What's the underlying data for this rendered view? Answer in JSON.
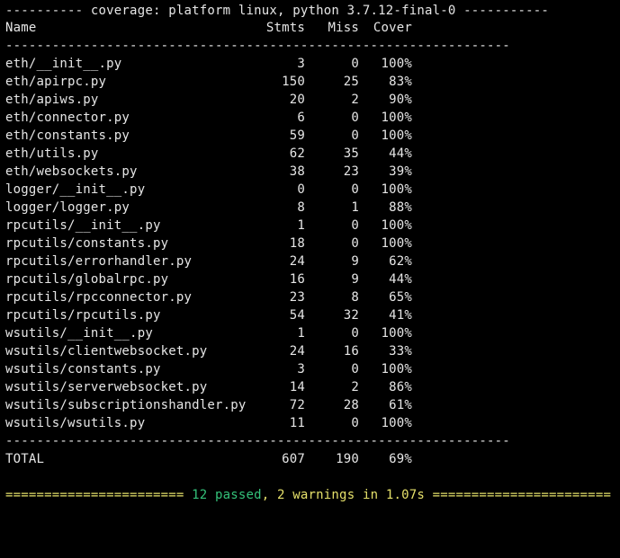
{
  "header": {
    "title_line": "---------- coverage: platform linux, python 3.7.12-final-0 -----------"
  },
  "columns": {
    "name": "Name",
    "stmts": "Stmts",
    "miss": "Miss",
    "cover": "Cover"
  },
  "separator": "-----------------------------------------------------------------",
  "rows": [
    {
      "name": "eth/__init__.py",
      "stmts": "3",
      "miss": "0",
      "cover": "100%"
    },
    {
      "name": "eth/apirpc.py",
      "stmts": "150",
      "miss": "25",
      "cover": "83%"
    },
    {
      "name": "eth/apiws.py",
      "stmts": "20",
      "miss": "2",
      "cover": "90%"
    },
    {
      "name": "eth/connector.py",
      "stmts": "6",
      "miss": "0",
      "cover": "100%"
    },
    {
      "name": "eth/constants.py",
      "stmts": "59",
      "miss": "0",
      "cover": "100%"
    },
    {
      "name": "eth/utils.py",
      "stmts": "62",
      "miss": "35",
      "cover": "44%"
    },
    {
      "name": "eth/websockets.py",
      "stmts": "38",
      "miss": "23",
      "cover": "39%"
    },
    {
      "name": "logger/__init__.py",
      "stmts": "0",
      "miss": "0",
      "cover": "100%"
    },
    {
      "name": "logger/logger.py",
      "stmts": "8",
      "miss": "1",
      "cover": "88%"
    },
    {
      "name": "rpcutils/__init__.py",
      "stmts": "1",
      "miss": "0",
      "cover": "100%"
    },
    {
      "name": "rpcutils/constants.py",
      "stmts": "18",
      "miss": "0",
      "cover": "100%"
    },
    {
      "name": "rpcutils/errorhandler.py",
      "stmts": "24",
      "miss": "9",
      "cover": "62%"
    },
    {
      "name": "rpcutils/globalrpc.py",
      "stmts": "16",
      "miss": "9",
      "cover": "44%"
    },
    {
      "name": "rpcutils/rpcconnector.py",
      "stmts": "23",
      "miss": "8",
      "cover": "65%"
    },
    {
      "name": "rpcutils/rpcutils.py",
      "stmts": "54",
      "miss": "32",
      "cover": "41%"
    },
    {
      "name": "wsutils/__init__.py",
      "stmts": "1",
      "miss": "0",
      "cover": "100%"
    },
    {
      "name": "wsutils/clientwebsocket.py",
      "stmts": "24",
      "miss": "16",
      "cover": "33%"
    },
    {
      "name": "wsutils/constants.py",
      "stmts": "3",
      "miss": "0",
      "cover": "100%"
    },
    {
      "name": "wsutils/serverwebsocket.py",
      "stmts": "14",
      "miss": "2",
      "cover": "86%"
    },
    {
      "name": "wsutils/subscriptionshandler.py",
      "stmts": "72",
      "miss": "28",
      "cover": "61%"
    },
    {
      "name": "wsutils/wsutils.py",
      "stmts": "11",
      "miss": "0",
      "cover": "100%"
    }
  ],
  "total": {
    "name": "TOTAL",
    "stmts": "607",
    "miss": "190",
    "cover": "69%"
  },
  "summary": {
    "left_bar": "======================= ",
    "passed": "12 passed",
    "comma": ", ",
    "warnings": "2 warnings in 1.07s",
    "right_bar": " ======================="
  },
  "colors": {
    "background": "#000000",
    "text": "#e6e6e6",
    "passed": "#34c27a",
    "warnings": "#e5e06a"
  }
}
